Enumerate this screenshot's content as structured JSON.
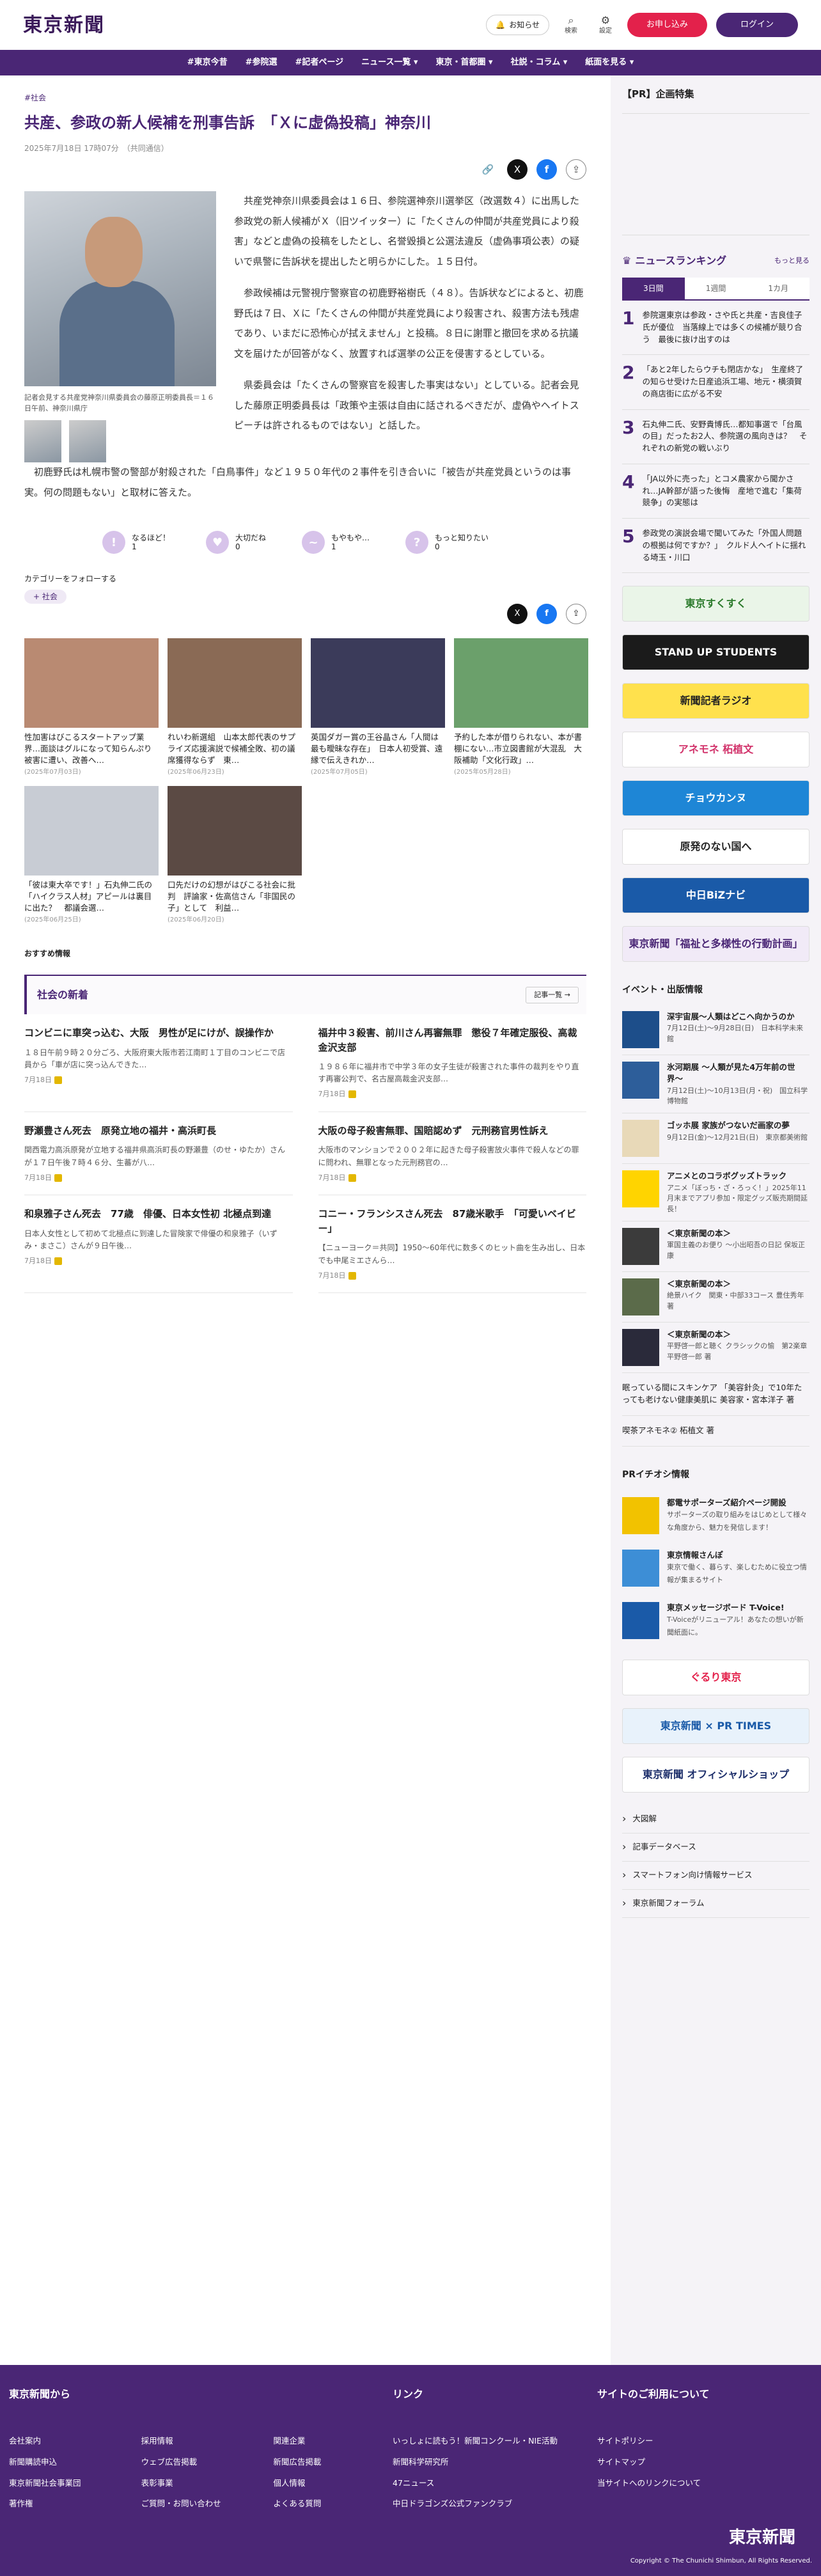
{
  "header": {
    "logo": "東京新聞",
    "notify": "お知らせ",
    "search": "検索",
    "settings": "設定",
    "subscribe": "お申し込み",
    "login": "ログイン"
  },
  "nav": [
    "#東京今昔",
    "#参院選",
    "#記者ページ",
    "ニュース一覧 ▾",
    "東京・首都圏 ▾",
    "社説・コラム ▾",
    "紙面を見る ▾"
  ],
  "article": {
    "tag": "#社会",
    "title": "共産、参政の新人候補を刑事告訴　「Ｘに虚偽投稿」神奈川",
    "date": "2025年7月18日 17時07分　（共同通信）",
    "caption": "記者会見する共産党神奈川県委員会の藤原正明委員長＝１６日午前、神奈川県庁",
    "p1": "共産党神奈川県委員会は１６日、参院選神奈川選挙区（改選数４）に出馬した参政党の新人候補がＸ（旧ツイッター）に「たくさんの仲間が共産党員により殺害」などと虚偽の投稿をしたとし、名誉毀損と公選法違反（虚偽事項公表）の疑いで県警に告訴状を提出したと明らかにした。１５日付。",
    "p2": "参政候補は元警視庁警察官の初鹿野裕樹氏（４８）。告訴状などによると、初鹿野氏は７日、Ｘに「たくさんの仲間が共産党員により殺害され、殺害方法も残虐であり、いまだに恐怖心が拭えません」と投稿。８日に謝罪と撤回を求める抗議文を届けたが回答がなく、放置すれば選挙の公正を侵害するとしている。",
    "p3": "県委員会は「たくさんの警察官を殺害した事実はない」としている。記者会見した藤原正明委員長は「政策や主張は自由に話されるべきだが、虚偽やヘイトスピーチは許されるものではない」と話した。",
    "p4": "初鹿野氏は札幌市警の警部が射殺された「白鳥事件」など１９５０年代の２事件を引き合いに「被告が共産党員というのは事実。何の問題もない」と取材に答えた。"
  },
  "reactions": [
    {
      "icon": "!",
      "label": "なるほど！",
      "count": "1"
    },
    {
      "icon": "♥",
      "label": "大切だね",
      "count": "0"
    },
    {
      "icon": "~",
      "label": "もやもや…",
      "count": "1"
    },
    {
      "icon": "?",
      "label": "もっと知りたい",
      "count": "0"
    }
  ],
  "follow": {
    "label": "カテゴリーをフォローする",
    "chip": "+ 社会"
  },
  "related": [
    {
      "title": "性加害はびこるスタートアップ業界…面談はグルになって知らんぷり　被害に遭い、改善へ…",
      "date": "(2025年07月03日)",
      "color": "#b98a72"
    },
    {
      "title": "れいわ新選組　山本太郎代表のサプライズ応援演説で候補全敗、初の議席獲得ならず　東…",
      "date": "(2025年06月23日)",
      "color": "#8a6a55"
    },
    {
      "title": "英国ダガー賞の王谷晶さん「人間は最も曖昧な存在」　日本人初受賞、遠縁で伝えきれか…",
      "date": "(2025年07月05日)",
      "color": "#3b3b5a"
    },
    {
      "title": "予約した本が借りられない、本が書棚にない…市立図書館が大混乱　大阪補助「文化行政」…",
      "date": "(2025年05月28日)",
      "color": "#6ba06b"
    },
    {
      "title": "「彼は東大卒です！」石丸伸二氏の「ハイクラス人材」アピールは裏目に出た？　都議会選…",
      "date": "(2025年06月25日)",
      "color": "#c8ccd4"
    },
    {
      "title": "口先だけの幻想がはびこる社会に批判　評論家・佐高信さん「非国民の子」として　利益…",
      "date": "(2025年06月20日)",
      "color": "#5b4a44"
    }
  ],
  "reco": "おすすめ情報",
  "news": {
    "title": "社会の新着",
    "more": "記事一覧",
    "items": [
      {
        "title": "コンビニに車突っ込む、大阪　男性が足にけが、誤操作か",
        "text": "１８日午前９時２０分ごろ、大阪府東大阪市若江南町１丁目のコンビニで店員から「車が店に突っ込んできた…",
        "date": "7月18日"
      },
      {
        "title": "福井中３殺害、前川さん再審無罪　懲役７年確定服役、高裁金沢支部",
        "text": "１９８６年に福井市で中学３年の女子生徒が殺害された事件の裁判をやり直す再審公判で、名古屋高裁金沢支部…",
        "date": "7月18日"
      },
      {
        "title": "野瀬豊さん死去　原発立地の福井・高浜町長",
        "text": "関西電力高浜原発が立地する福井県高浜町長の野瀬豊（のせ・ゆたか）さんが１７日午後７時４６分、生蕃が八…",
        "date": "7月18日"
      },
      {
        "title": "大阪の母子殺害無罪、国賠認めず　元刑務官男性訴え",
        "text": "大阪市のマンションで２００２年に起きた母子殺害放火事件で殺人などの罪に問われ、無罪となった元刑務官の…",
        "date": "7月18日"
      },
      {
        "title": "和泉雅子さん死去　77歳　俳優、日本女性初 北極点到達",
        "text": "日本人女性として初めて北極点に到達した冒険家で俳優の和泉雅子（いずみ・まさこ）さんが９日午後…",
        "date": "7月18日"
      },
      {
        "title": "コニー・フランシスさん死去　87歳米歌手　「可愛いベイビー」",
        "text": "【ニューヨーク＝共同】1950〜60年代に数多くのヒット曲を生み出し、日本でも中尾ミエさんら…",
        "date": "7月18日"
      }
    ]
  },
  "side": {
    "pr": "【PR】企画特集",
    "ranking": {
      "title": "ニュースランキング",
      "more": "もっと見る",
      "tabs": [
        "3日間",
        "1週間",
        "1カ月"
      ],
      "items": [
        "参院選東京は参政・さや氏と共産・吉良佳子氏が優位　当落線上では多くの候補が競り合う　最後に抜け出すのは",
        "「あと2年したらウチも閉店かな」　生産終了の知らせ受けた日産追浜工場、地元・横須賀の商店街に広がる不安",
        "石丸伸二氏、安野貴博氏…都知事選で「台風の目」だったお2人、参院選の風向きは？　それぞれの新党の戦いぶり",
        "「JA以外に売った」とコメ農家から聞かされ…JA幹部が語った後悔　産地で進む「集荷競争」の実態は",
        "参政党の演説会場で聞いてみた「外国人問題の根拠は何ですか？」　クルド人ヘイトに揺れる埼玉・川口"
      ]
    },
    "banners": [
      {
        "text": "東京すくすく",
        "bg": "#eaf5e8",
        "fg": "#2b7a2b"
      },
      {
        "text": "STAND UP STUDENTS",
        "bg": "#1b1b1b",
        "fg": "#fff"
      },
      {
        "text": "新聞記者ラジオ",
        "bg": "#ffe14d",
        "fg": "#222"
      },
      {
        "text": "アネモネ 柘植文",
        "bg": "#fff",
        "fg": "#d2336b"
      },
      {
        "text": "チョウカンヌ",
        "bg": "#1e86d6",
        "fg": "#fff"
      },
      {
        "text": "原発のない国へ",
        "bg": "#fff",
        "fg": "#222"
      },
      {
        "text": "中日BiZナビ",
        "bg": "#1a5aa8",
        "fg": "#fff"
      },
      {
        "text": "東京新聞「福祉と多様性の行動計画」",
        "bg": "#f1eaf7",
        "fg": "#4a2675"
      }
    ],
    "events": {
      "title": "イベント・出版情報",
      "items": [
        {
          "title": "深宇宙展〜人類はどこへ向かうのか",
          "meta": "7月12日(土)〜9月28日(日)　日本科学未来館",
          "color": "#1d4e8a"
        },
        {
          "title": "氷河期展 〜人類が見た4万年前の世界〜",
          "meta": "7月12日(土)〜10月13日(月・祝)　国立科学博物館",
          "color": "#2d5e9a"
        },
        {
          "title": "ゴッホ展 家族がつないだ画家の夢",
          "meta": "9月12日(金)〜12月21日(日)　東京都美術館",
          "color": "#e8d9b8"
        },
        {
          "title": "アニメとのコラボグッズトラック",
          "meta": "アニメ「ぼっち・ざ・ろっく！」2025年11月末までアプリ参加・限定グッズ販売期間延長！",
          "color": "#ffd400"
        },
        {
          "title": "＜東京新聞の本＞",
          "meta": "軍国主義のお便り ～小出昭吾の日記 保坂正康",
          "color": "#3b3b3b"
        },
        {
          "title": "＜東京新聞の本＞",
          "meta": "絶景ハイク　関東・中部33コース 豊住秀年 著",
          "color": "#5b6b4a"
        },
        {
          "title": "＜東京新聞の本＞",
          "meta": "平野啓一郎と聴く クラシックの愉　第2楽章 平野啓一郎 著",
          "color": "#2a2a3a"
        }
      ],
      "plain": [
        "眠っている間にスキンケア 「美容針灸」で10年たっても老けない健康美肌に 美容家・宮本洋子 著",
        "喫茶アネモネ② 柘植文 著"
      ]
    },
    "prinfo": {
      "title": "PRイチオシ情報",
      "items": [
        {
          "title": "都電サポーターズ紹介ページ開設",
          "text": "サポーターズの取り組みをはじめとして様々な角度から、魅力を発信します！",
          "color": "#f2c200"
        },
        {
          "title": "東京情報さんぽ",
          "text": "東京で働く、暮らす、楽しむために役立つ情報が集まるサイト",
          "color": "#3d8ed6"
        },
        {
          "title": "東京メッセージボード T-Voice!",
          "text": "T-Voiceがリニューアル！あなたの想いが新聞紙面に。",
          "color": "#1a5aa8"
        }
      ]
    },
    "banners2": [
      {
        "text": "ぐるり東京",
        "bg": "#fff",
        "fg": "#e3214b"
      },
      {
        "text": "東京新聞 × PR TIMES",
        "bg": "#e8f2fb",
        "fg": "#1a5aa8"
      },
      {
        "text": "東京新聞 オフィシャルショップ",
        "bg": "#fff",
        "fg": "#1d2f6b"
      }
    ],
    "links": [
      "大図解",
      "記事データベース",
      "スマートフォン向け情報サービス",
      "東京新聞フォーラム"
    ]
  },
  "footer": {
    "c1": {
      "title": "東京新聞から",
      "a": [
        "会社案内",
        "新聞購読申込",
        "東京新聞社会事業団",
        "著作権"
      ],
      "b": [
        "採用情報",
        "ウェブ広告掲載",
        "表彰事業",
        "ご質問・お問い合わせ"
      ],
      "c": [
        "関連企業",
        "新聞広告掲載",
        "個人情報",
        "よくある質問"
      ]
    },
    "c2": {
      "title": "リンク",
      "a": [
        "いっしょに読もう！新聞コンクール・NIE活動",
        "新聞科学研究所",
        "47ニュース",
        "中日ドラゴンズ公式ファンクラブ"
      ]
    },
    "c3": {
      "title": "サイトのご利用について",
      "a": [
        "サイトポリシー",
        "サイトマップ",
        "当サイトへのリンクについて"
      ]
    },
    "logo": "東京新聞",
    "copy": "Copyright © The Chunichi Shimbun, All Rights Reserved."
  }
}
